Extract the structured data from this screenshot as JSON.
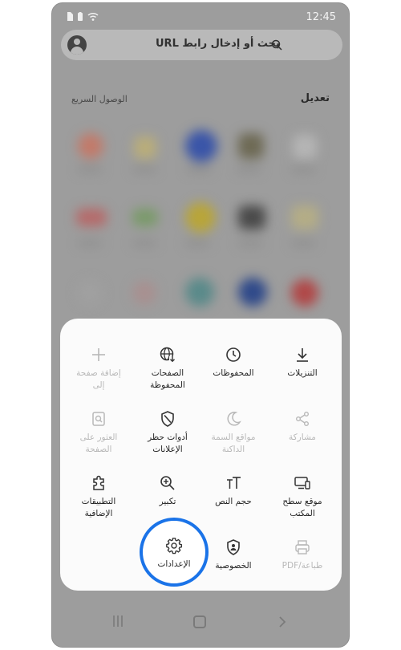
{
  "status": {
    "time": "12:45"
  },
  "search": {
    "text": "بحث أو إدخال رابط URL"
  },
  "header": {
    "edit": "تعديل",
    "quick_access": "الوصول السريع"
  },
  "menu": {
    "row1": [
      {
        "label": "التنزيلات",
        "icon": "download-icon",
        "enabled": true
      },
      {
        "label": "المحفوظات",
        "icon": "clock-icon",
        "enabled": true
      },
      {
        "label": "الصفحات المحفوظة",
        "icon": "globe-download-icon",
        "enabled": true
      },
      {
        "label": "إضافة صفحة إلى",
        "icon": "plus-icon",
        "enabled": false
      }
    ],
    "row2": [
      {
        "label": "مشاركة",
        "icon": "share-icon",
        "enabled": false
      },
      {
        "label": "مواقع السمة الداكنة",
        "icon": "moon-icon",
        "enabled": false
      },
      {
        "label": "أدوات حظر الإعلانات",
        "icon": "shield-slash-icon",
        "enabled": true
      },
      {
        "label": "العثور على الصفحة",
        "icon": "find-in-page-icon",
        "enabled": false
      }
    ],
    "row3": [
      {
        "label": "موقع سطح المكتب",
        "icon": "desktop-icon",
        "enabled": true
      },
      {
        "label": "حجم النص",
        "icon": "text-size-icon",
        "enabled": true
      },
      {
        "label": "تكبير",
        "icon": "zoom-in-icon",
        "enabled": true
      },
      {
        "label": "التطبيقات الإضافية",
        "icon": "puzzle-icon",
        "enabled": true
      }
    ],
    "row4": [
      {
        "label": "طباعة/PDF",
        "icon": "print-icon",
        "enabled": false
      },
      {
        "label": "الخصوصية",
        "icon": "privacy-shield-icon",
        "enabled": true
      },
      {
        "label": "الإعدادات",
        "icon": "gear-icon",
        "enabled": true
      }
    ]
  },
  "colors": {
    "highlight": "#1a73e8",
    "overlay": "#9d9d9d",
    "sheet": "#fbfbfb"
  }
}
